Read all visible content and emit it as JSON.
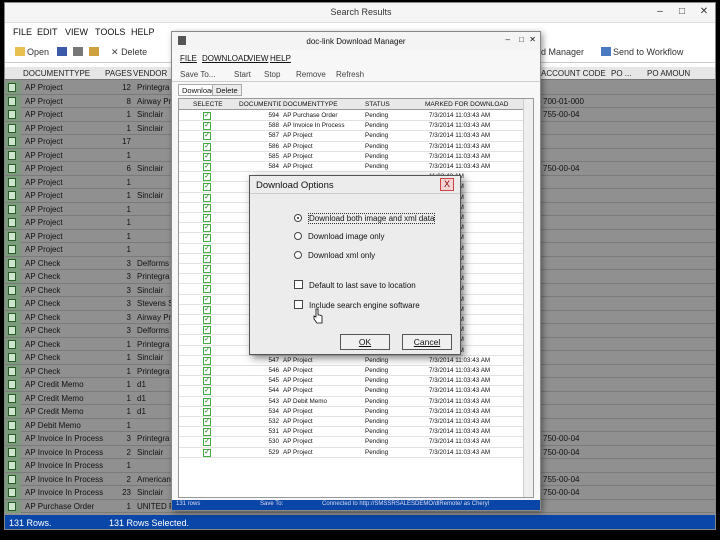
{
  "main": {
    "title": "Search Results",
    "menus": [
      "FILE",
      "EDIT",
      "VIEW",
      "TOOLS",
      "HELP"
    ],
    "toolbar": {
      "open": "Open",
      "delete": "Delete",
      "manager": "d Manager",
      "workflow": "Send to Workflow"
    },
    "columns": {
      "doctype": "DOCUMENTTYPE",
      "pages": "PAGES",
      "vendor": "VENDOR",
      "account": "ACCOUNT CODE",
      "po": "PO ...",
      "poamt": "PO AMOUN"
    },
    "rows": [
      {
        "type": "AP Project",
        "pages": "12",
        "vendor": "Printegra",
        "acct": ""
      },
      {
        "type": "AP Project",
        "pages": "8",
        "vendor": "Airway Pr",
        "acct": "700-01-000"
      },
      {
        "type": "AP Project",
        "pages": "1",
        "vendor": "Sinclair",
        "acct": "755-00-04"
      },
      {
        "type": "AP Project",
        "pages": "1",
        "vendor": "Sinclair",
        "acct": ""
      },
      {
        "type": "AP Project",
        "pages": "17",
        "vendor": "",
        "acct": ""
      },
      {
        "type": "AP Project",
        "pages": "1",
        "vendor": "",
        "acct": ""
      },
      {
        "type": "AP Project",
        "pages": "6",
        "vendor": "Sinclair",
        "acct": "750-00-04"
      },
      {
        "type": "AP Project",
        "pages": "1",
        "vendor": "",
        "acct": ""
      },
      {
        "type": "AP Project",
        "pages": "1",
        "vendor": "Sinclair",
        "acct": ""
      },
      {
        "type": "AP Project",
        "pages": "1",
        "vendor": "",
        "acct": ""
      },
      {
        "type": "AP Project",
        "pages": "1",
        "vendor": "",
        "acct": ""
      },
      {
        "type": "AP Project",
        "pages": "1",
        "vendor": "",
        "acct": ""
      },
      {
        "type": "AP Project",
        "pages": "1",
        "vendor": "",
        "acct": ""
      },
      {
        "type": "AP Check",
        "pages": "3",
        "vendor": "Delforms",
        "acct": ""
      },
      {
        "type": "AP Check",
        "pages": "3",
        "vendor": "Printegra",
        "acct": ""
      },
      {
        "type": "AP Check",
        "pages": "3",
        "vendor": "Sinclair",
        "acct": ""
      },
      {
        "type": "AP Check",
        "pages": "3",
        "vendor": "Stevens Sc",
        "acct": ""
      },
      {
        "type": "AP Check",
        "pages": "3",
        "vendor": "Airway Pr",
        "acct": ""
      },
      {
        "type": "AP Check",
        "pages": "3",
        "vendor": "Delforms",
        "acct": ""
      },
      {
        "type": "AP Check",
        "pages": "1",
        "vendor": "Printegra",
        "acct": ""
      },
      {
        "type": "AP Check",
        "pages": "1",
        "vendor": "Sinclair",
        "acct": ""
      },
      {
        "type": "AP Check",
        "pages": "1",
        "vendor": "Printegra",
        "acct": ""
      },
      {
        "type": "AP Credit Memo",
        "pages": "1",
        "vendor": "d1",
        "acct": ""
      },
      {
        "type": "AP Credit Memo",
        "pages": "1",
        "vendor": "d1",
        "acct": ""
      },
      {
        "type": "AP Credit Memo",
        "pages": "1",
        "vendor": "d1",
        "acct": ""
      },
      {
        "type": "AP Debit Memo",
        "pages": "1",
        "vendor": "",
        "acct": ""
      },
      {
        "type": "AP Invoice In Process",
        "pages": "3",
        "vendor": "Printegra",
        "acct": "750-00-04"
      },
      {
        "type": "AP Invoice In Process",
        "pages": "2",
        "vendor": "Sinclair",
        "acct": "750-00-04"
      },
      {
        "type": "AP Invoice In Process",
        "pages": "1",
        "vendor": "",
        "acct": ""
      },
      {
        "type": "AP Invoice In Process",
        "pages": "2",
        "vendor": "American",
        "acct": "755-00-04"
      },
      {
        "type": "AP Invoice In Process",
        "pages": "23",
        "vendor": "Sinclair",
        "acct": "750-00-04"
      },
      {
        "type": "AP Purchase Order",
        "pages": "1",
        "vendor": "UNITED P",
        "acct": ""
      }
    ],
    "status": {
      "rows": "131 Rows.",
      "selected": "131 Rows Selected."
    }
  },
  "manager": {
    "title": "doc-link Download Manager",
    "menus": [
      "FILE",
      "DOWNLOAD",
      "VIEW",
      "HELP"
    ],
    "toolbar": [
      "Save To...",
      "Start",
      "Stop",
      "Remove",
      "Refresh"
    ],
    "tabs": [
      "Download",
      "Delete"
    ],
    "columns": [
      "SELECTED",
      "DOCUMENTID",
      "DOCUMENTTYPE",
      "STATUS",
      "MARKED FOR DOWNLOAD"
    ],
    "rows": [
      {
        "id": "594",
        "type": "AP Purchase Order",
        "status": "Pending",
        "date": "7/3/2014 11:03:43 AM"
      },
      {
        "id": "588",
        "type": "AP Invoice In Process",
        "status": "Pending",
        "date": "7/3/2014 11:03:43 AM"
      },
      {
        "id": "587",
        "type": "AP Project",
        "status": "Pending",
        "date": "7/3/2014 11:03:43 AM"
      },
      {
        "id": "586",
        "type": "AP Project",
        "status": "Pending",
        "date": "7/3/2014 11:03:43 AM"
      },
      {
        "id": "585",
        "type": "AP Project",
        "status": "Pending",
        "date": "7/3/2014 11:03:43 AM"
      },
      {
        "id": "584",
        "type": "AP Project",
        "status": "Pending",
        "date": "7/3/2014 11:03:43 AM"
      },
      {
        "id": "",
        "type": "",
        "status": "",
        "date": "11:03:43 AM"
      },
      {
        "id": "",
        "type": "",
        "status": "",
        "date": "11:03:43 AM"
      },
      {
        "id": "",
        "type": "",
        "status": "",
        "date": "11:03:43 AM"
      },
      {
        "id": "",
        "type": "",
        "status": "",
        "date": "11:03:43 AM"
      },
      {
        "id": "",
        "type": "",
        "status": "",
        "date": "11:03:43 AM"
      },
      {
        "id": "",
        "type": "",
        "status": "",
        "date": "11:03:43 AM"
      },
      {
        "id": "",
        "type": "",
        "status": "",
        "date": "11:03:43 AM"
      },
      {
        "id": "",
        "type": "",
        "status": "",
        "date": "11:03:43 AM"
      },
      {
        "id": "",
        "type": "",
        "status": "",
        "date": "11:03:43 AM"
      },
      {
        "id": "",
        "type": "",
        "status": "",
        "date": "11:03:43 AM"
      },
      {
        "id": "",
        "type": "",
        "status": "",
        "date": "11:03:43 AM"
      },
      {
        "id": "",
        "type": "",
        "status": "",
        "date": "11:03:43 AM"
      },
      {
        "id": "",
        "type": "",
        "status": "",
        "date": "11:03:43 AM"
      },
      {
        "id": "",
        "type": "",
        "status": "",
        "date": "11:03:43 AM"
      },
      {
        "id": "",
        "type": "",
        "status": "",
        "date": "11:03:43 AM"
      },
      {
        "id": "",
        "type": "",
        "status": "",
        "date": "11:03:43 AM"
      },
      {
        "id": "",
        "type": "",
        "status": "",
        "date": "11:03:43 AM"
      },
      {
        "id": "",
        "type": "",
        "status": "",
        "date": "11:03:43 AM"
      },
      {
        "id": "547",
        "type": "AP Project",
        "status": "Pending",
        "date": "7/3/2014 11:03:43 AM"
      },
      {
        "id": "546",
        "type": "AP Project",
        "status": "Pending",
        "date": "7/3/2014 11:03:43 AM"
      },
      {
        "id": "545",
        "type": "AP Project",
        "status": "Pending",
        "date": "7/3/2014 11:03:43 AM"
      },
      {
        "id": "544",
        "type": "AP Project",
        "status": "Pending",
        "date": "7/3/2014 11:03:43 AM"
      },
      {
        "id": "543",
        "type": "AP Debit Memo",
        "status": "Pending",
        "date": "7/3/2014 11:03:43 AM"
      },
      {
        "id": "534",
        "type": "AP Project",
        "status": "Pending",
        "date": "7/3/2014 11:03:43 AM"
      },
      {
        "id": "532",
        "type": "AP Project",
        "status": "Pending",
        "date": "7/3/2014 11:03:43 AM"
      },
      {
        "id": "531",
        "type": "AP Project",
        "status": "Pending",
        "date": "7/3/2014 11:03:43 AM"
      },
      {
        "id": "530",
        "type": "AP Project",
        "status": "Pending",
        "date": "7/3/2014 11:03:43 AM"
      },
      {
        "id": "529",
        "type": "AP Project",
        "status": "Pending",
        "date": "7/3/2014 11:03:43 AM"
      }
    ],
    "status": {
      "rows": "131 rows",
      "save": "Save To:",
      "conn": "Connected to http://SMSSRSALESDEMO/dlRemote/ as Cheryl"
    }
  },
  "dialog": {
    "title": "Download Options",
    "close": "X",
    "opt1": "Download both image and xml data",
    "opt2": "Download image only",
    "opt3": "Download xml only",
    "chk1": "Default to last save to location",
    "chk2": "Include search engine software",
    "ok": "OK",
    "cancel": "Cancel"
  }
}
